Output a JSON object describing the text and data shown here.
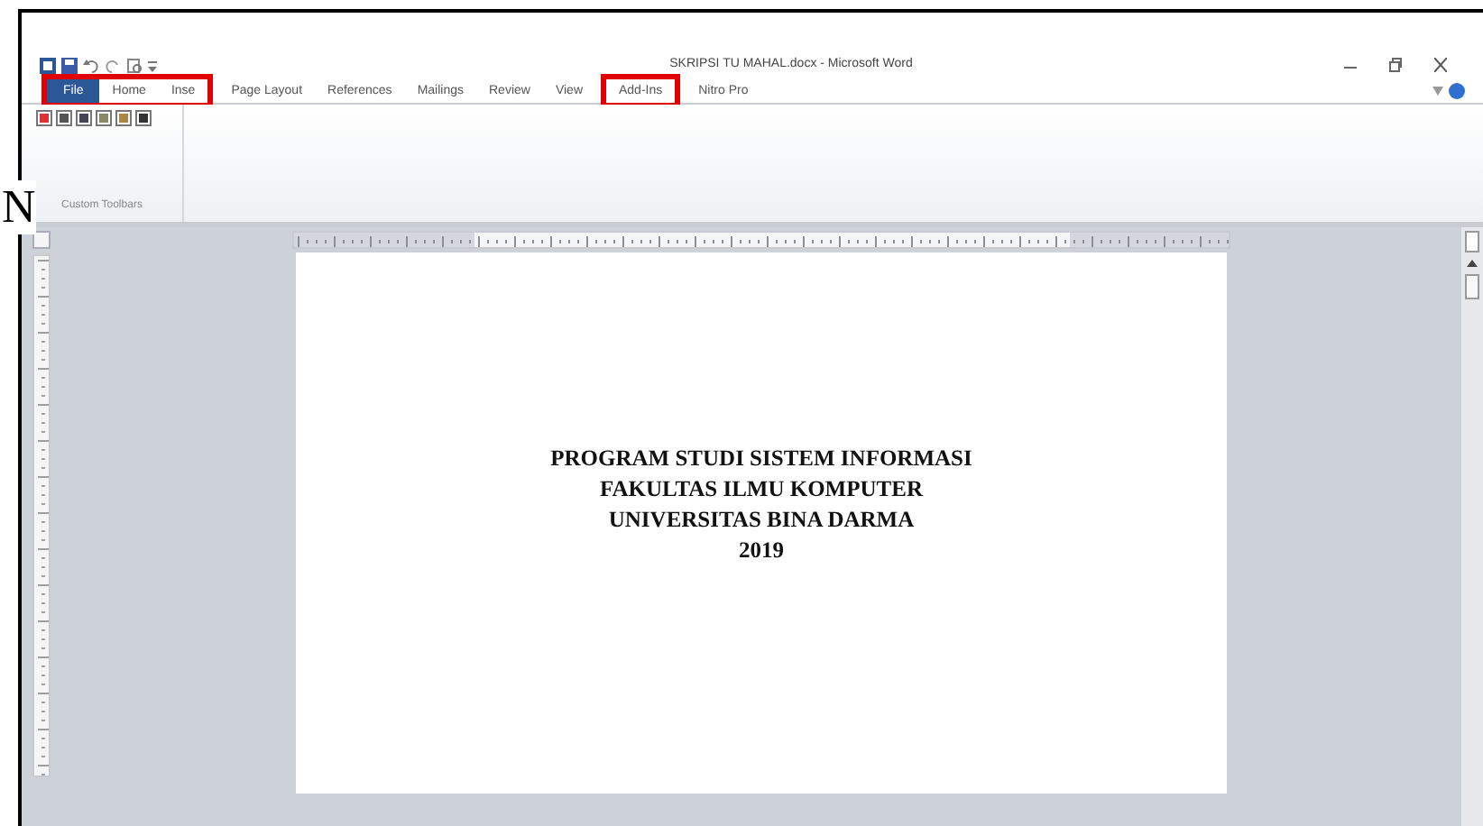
{
  "stray_letter": "N",
  "window": {
    "title": "SKRIPSI TU MAHAL.docx - Microsoft Word"
  },
  "tab_groups": [
    {
      "boxed": true,
      "tabs": [
        {
          "label": "File",
          "selected": true
        },
        {
          "label": "Home",
          "selected": false
        },
        {
          "label": "Inse",
          "selected": false
        }
      ]
    },
    {
      "boxed": false,
      "tabs": [
        {
          "label": "Page Layout",
          "selected": false
        },
        {
          "label": "References",
          "selected": false
        },
        {
          "label": "Mailings",
          "selected": false
        },
        {
          "label": "Review",
          "selected": false
        },
        {
          "label": "View",
          "selected": false
        }
      ]
    },
    {
      "boxed": true,
      "tabs": [
        {
          "label": "Add-Ins",
          "selected": false
        }
      ]
    },
    {
      "boxed": false,
      "tabs": [
        {
          "label": "Nitro Pro",
          "selected": false
        }
      ]
    }
  ],
  "ribbon": {
    "group_label": "Custom Toolbars"
  },
  "document": {
    "lines": [
      "PROGRAM STUDI SISTEM INFORMASI",
      "FAKULTAS ILMU KOMPUTER",
      "UNIVERSITAS BINA DARMA",
      "2019"
    ]
  }
}
